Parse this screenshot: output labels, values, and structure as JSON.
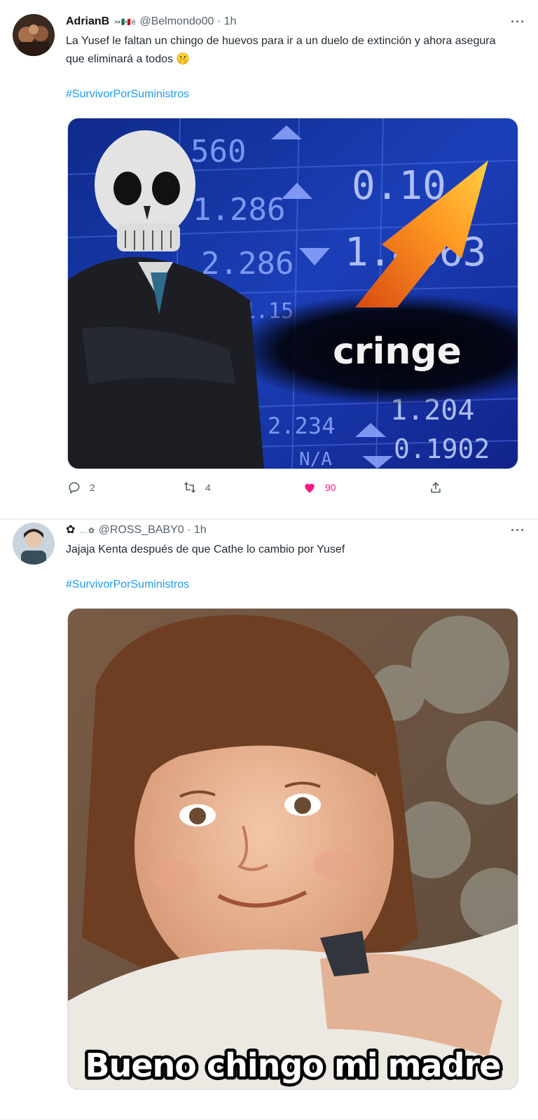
{
  "tweets": [
    {
      "name": "AdrianB",
      "badges": "×• 🇲🇽 é",
      "handle": "@Belmondo00",
      "separator": "·",
      "time": "1h",
      "text": "La Yusef le faltan un chingo de huevos para ir a un duelo de extinción y ahora asegura que eliminará a todos 🤫",
      "hashtag": "#SurvivorPorSuministros",
      "media": {
        "numbers": [
          "560",
          "1.286",
          "2.286",
          "0.10",
          "1.4563",
          "1.204",
          "0.1902",
          "2.234",
          "1.15",
          "N/A"
        ],
        "caption": "cringe"
      },
      "actions": {
        "replies": "2",
        "retweets": "4",
        "likes": "90"
      }
    },
    {
      "name": "✿",
      "badges": "… ✿",
      "handle": "@ROSS_BABY0",
      "separator": "·",
      "time": "1h",
      "text": "Jajaja Kenta después de que Cathe lo cambio por Yusef",
      "hashtag": "#SurvivorPorSuministros",
      "media": {
        "caption": "Bueno chingo mi madre"
      }
    }
  ],
  "colors": {
    "link": "#1d9bf0",
    "like": "#f91880",
    "muted": "#536471"
  },
  "icons": [
    "more-icon",
    "reply-icon",
    "retweet-icon",
    "like-icon",
    "share-icon"
  ]
}
